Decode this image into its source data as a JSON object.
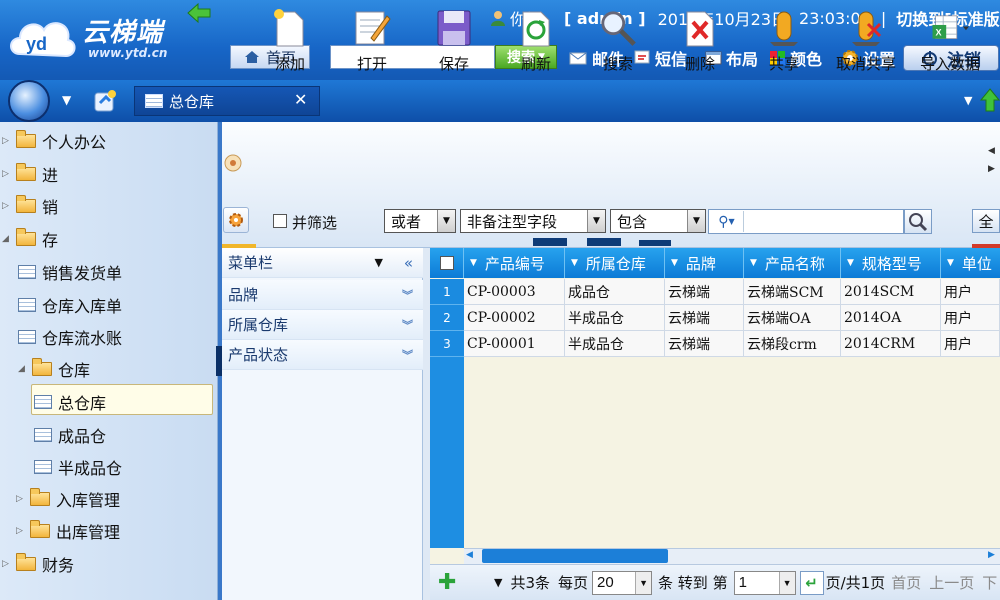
{
  "brand": {
    "name": "云梯端",
    "url": "www.ytd.cn"
  },
  "header": {
    "greeting": "你好，",
    "username": "[ admin ]",
    "date": "2015年10月23日",
    "time": "23:03:08",
    "separator": "|",
    "switch_version": "切换到[标准版]",
    "home_label": "首页",
    "search_placeholder": "",
    "search_button": "搜索",
    "nav": {
      "mail": "邮件",
      "sms": "短信",
      "layout": "布局",
      "color": "颜色",
      "settings": "设置"
    },
    "logout_label": "注销"
  },
  "tabs": {
    "active": "总仓库"
  },
  "sidebar": {
    "items": [
      {
        "label": "个人办公"
      },
      {
        "label": "进"
      },
      {
        "label": "销"
      },
      {
        "label": "存"
      },
      {
        "label": "销售发货单"
      },
      {
        "label": "仓库入库单"
      },
      {
        "label": "仓库流水账"
      },
      {
        "label": "仓库"
      },
      {
        "label": "总仓库"
      },
      {
        "label": "成品仓"
      },
      {
        "label": "半成品仓"
      },
      {
        "label": "入库管理"
      },
      {
        "label": "出库管理"
      },
      {
        "label": "财务"
      }
    ]
  },
  "toolbar": {
    "add": "添加",
    "open": "打开",
    "save": "保存",
    "refresh": "刷新",
    "search": "搜索",
    "delete": "删除",
    "share": "共享",
    "unshare": "取消共享",
    "import": "导入数据"
  },
  "filter": {
    "combine_label": "并筛选",
    "logic": "或者",
    "field": "非备注型字段",
    "operator": "包含",
    "value": "",
    "all_button": "全"
  },
  "menu_panel": {
    "title": "菜单栏",
    "groups": [
      "品牌",
      "所属仓库",
      "产品状态"
    ]
  },
  "grid": {
    "columns": [
      "产品编号",
      "所属仓库",
      "品牌",
      "产品名称",
      "规格型号",
      "单位"
    ],
    "rows": [
      {
        "n": "1",
        "cells": [
          "CP-00003",
          "成品仓",
          "云梯端",
          "云梯端SCM",
          "2014SCM",
          "用户"
        ]
      },
      {
        "n": "2",
        "cells": [
          "CP-00002",
          "半成品仓",
          "云梯端",
          "云梯端OA",
          "2014OA",
          "用户"
        ]
      },
      {
        "n": "3",
        "cells": [
          "CP-00001",
          "半成品仓",
          "云梯端",
          "云梯段crm",
          "2014CRM",
          "用户"
        ]
      }
    ]
  },
  "pager": {
    "total": "共3条",
    "per_page_label": "每页",
    "per_page": "20",
    "goto_label": "条 转到 第",
    "page": "1",
    "page_suffix": "页/共1页",
    "first": "首页",
    "prev": "上一页",
    "next": "下"
  },
  "colors": {
    "header_blue": "#1766c7",
    "grid_header": "#1b8be0",
    "search_green": "#4aa823"
  }
}
